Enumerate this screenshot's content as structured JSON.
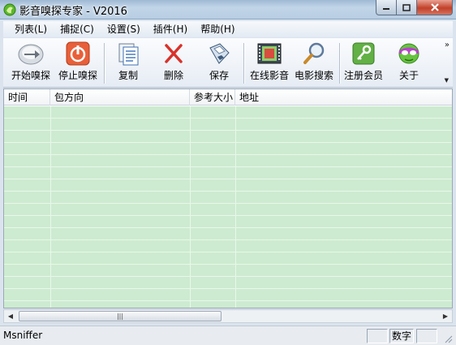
{
  "window": {
    "title": "影音嗅探专家 - V2016"
  },
  "menu": [
    "列表(L)",
    "捕捉(C)",
    "设置(S)",
    "插件(H)",
    "帮助(H)"
  ],
  "toolbar": {
    "start": "开始嗅探",
    "stop": "停止嗅探",
    "copy": "复制",
    "delete": "删除",
    "save": "保存",
    "online": "在线影音",
    "search": "电影搜索",
    "register": "注册会员",
    "about": "关于"
  },
  "list": {
    "columns": [
      "时间",
      "包方向",
      "参考大小",
      "地址"
    ]
  },
  "status": {
    "text": "Msniffer",
    "panel": "数字"
  },
  "colors": {
    "row": "#cdebd0",
    "row_line": "#e9f7ea",
    "titlebar": "#b8cde3"
  }
}
